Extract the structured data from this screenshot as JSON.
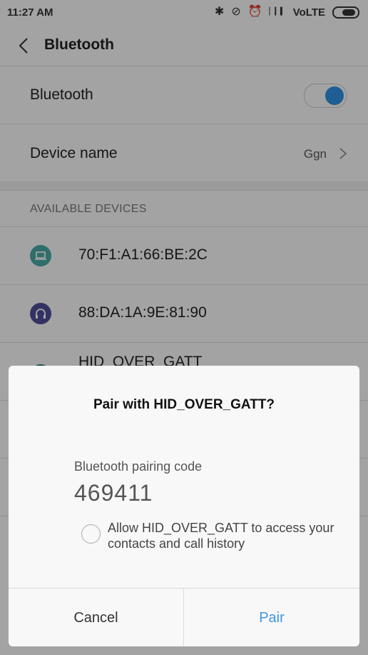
{
  "status_bar": {
    "time": "11:27 AM",
    "network": "VoLTE"
  },
  "title_bar": {
    "title": "Bluetooth"
  },
  "settings": {
    "bluetooth_label": "Bluetooth",
    "bluetooth_on": true,
    "device_name_label": "Device name",
    "device_name_value": "Ggn"
  },
  "available": {
    "header": "AVAILABLE DEVICES",
    "devices": [
      {
        "name": "70:F1:A1:66:BE:2C",
        "icon": "laptop-icon",
        "color": "#4aa7a3"
      },
      {
        "name": "88:DA:1A:9E:81:90",
        "icon": "headphones-icon",
        "color": "#4c4e97"
      },
      {
        "name": "HID_OVER_GATT",
        "icon": "keyboard-icon",
        "color": "#1e7f79"
      }
    ]
  },
  "dialog": {
    "title": "Pair with HID_OVER_GATT?",
    "code_label": "Bluetooth pairing code",
    "code": "469411",
    "allow_text": "Allow HID_OVER_GATT to access your contacts and call history",
    "cancel_label": "Cancel",
    "pair_label": "Pair"
  },
  "colors": {
    "accent": "#2f8fdf",
    "pair_text": "#3d97e6",
    "background": "#f7f7f7"
  }
}
